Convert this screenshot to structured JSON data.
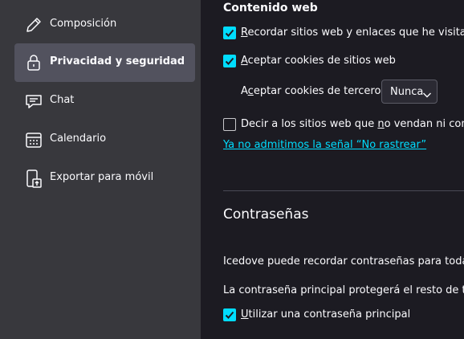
{
  "sidebar": {
    "items": [
      {
        "label": "Composición",
        "icon": "pencil-icon"
      },
      {
        "label": "Privacidad y seguridad",
        "icon": "lock-icon",
        "active": true
      },
      {
        "label": "Chat",
        "icon": "chat-icon"
      },
      {
        "label": "Calendario",
        "icon": "calendar-icon"
      },
      {
        "label": "Exportar para móvil",
        "icon": "mobile-export-icon"
      }
    ]
  },
  "content": {
    "web_section_title": "Contenido web",
    "remember_sites": {
      "pre": "",
      "u": "R",
      "post": "ecordar sitios web y enlaces que he visitado",
      "checked": true
    },
    "accept_cookies": {
      "pre": "",
      "u": "A",
      "post": "ceptar cookies de sitios web",
      "checked": true
    },
    "third_party": {
      "pre": "A",
      "u": "c",
      "post": "eptar cookies de terceros:",
      "value": "Nunca"
    },
    "do_not_sell": {
      "pre": "Decir a los sitios web que ",
      "u": "n",
      "post": "o vendan ni compart",
      "checked": false
    },
    "dnt_link": "Ya no admitimos la señal “No rastrear”",
    "passwords_title": "Contraseñas",
    "passwords_text1": "Icedove puede recordar contraseñas para todas tus",
    "passwords_text2": "La contraseña principal protegerá el resto de tus c",
    "primary_password": {
      "pre": "",
      "u": "U",
      "post": "tilizar una contraseña principal",
      "checked": true
    }
  },
  "colors": {
    "accent": "#00ddff",
    "background": "#1c1b22",
    "sidebar": "#38383d"
  }
}
